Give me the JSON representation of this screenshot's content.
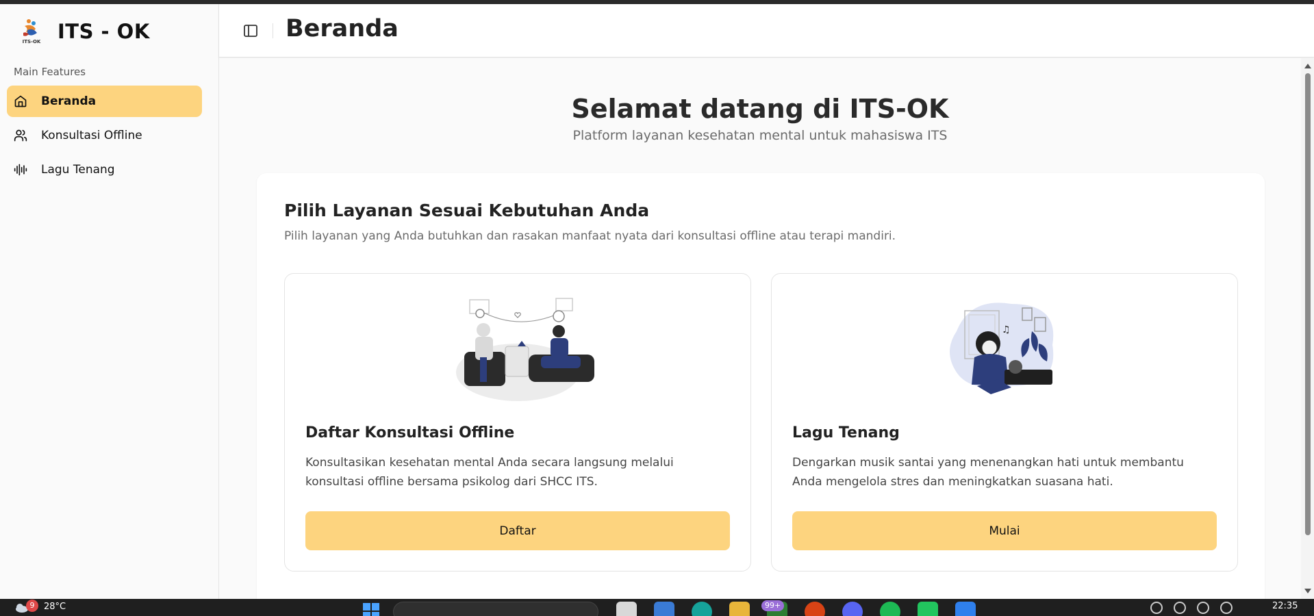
{
  "app": {
    "brand_name": "ITS - OK",
    "logo_text": "ITS-OK"
  },
  "sidebar": {
    "section_label": "Main Features",
    "items": [
      {
        "label": "Beranda",
        "icon": "home-icon",
        "active": true
      },
      {
        "label": "Konsultasi Offline",
        "icon": "users-icon",
        "active": false
      },
      {
        "label": "Lagu Tenang",
        "icon": "audio-waveform-icon",
        "active": false
      }
    ]
  },
  "header": {
    "title": "Beranda"
  },
  "main": {
    "welcome_title": "Selamat datang di ITS-OK",
    "welcome_subtitle": "Platform layanan kesehatan mental untuk mahasiswa ITS",
    "services_title": "Pilih Layanan Sesuai Kebutuhan Anda",
    "services_subtitle": "Pilih layanan yang Anda butuhkan dan rasakan manfaat nyata dari konsultasi offline atau terapi mandiri.",
    "cards": [
      {
        "title": "Daftar Konsultasi Offline",
        "text": "Konsultasikan kesehatan mental Anda secara langsung melalui konsultasi offline bersama psikolog dari SHCC ITS.",
        "button": "Daftar",
        "illustration": "counseling-illustration"
      },
      {
        "title": "Lagu Tenang",
        "text": "Dengarkan musik santai yang menenangkan hati untuk membantu Anda mengelola stres dan meningkatkan suasana hati.",
        "button": "Mulai",
        "illustration": "music-listening-illustration"
      }
    ]
  },
  "taskbar": {
    "weather_temp": "28°C",
    "weather_badge": "9",
    "app_badge": "99+",
    "clock": "22:35"
  },
  "colors": {
    "accent": "#fdd47f",
    "illustration_blue": "#2d3e7c",
    "illustration_light": "#dfe4f5"
  }
}
